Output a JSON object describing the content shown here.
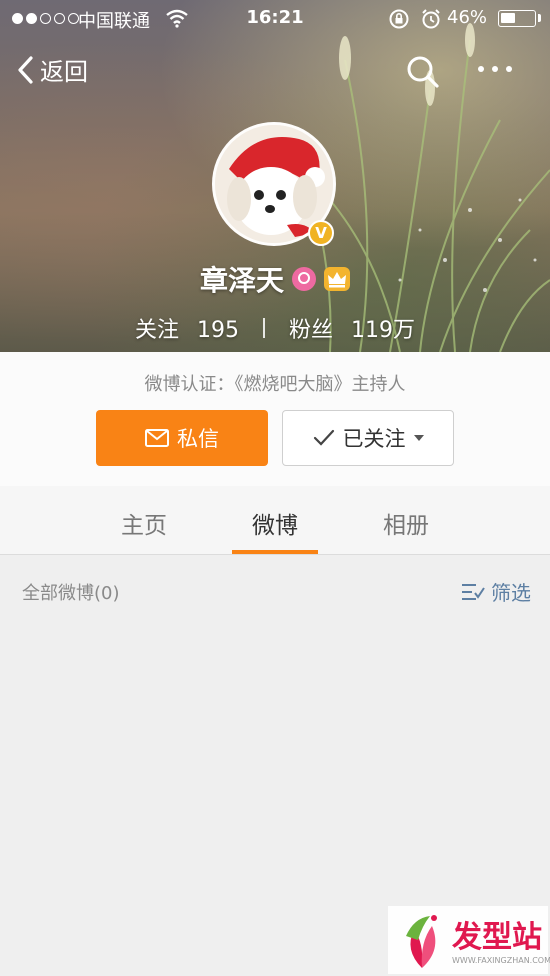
{
  "status_bar": {
    "carrier": "中国联通",
    "time": "16:21",
    "battery_percent": "46%",
    "battery_level": 0.46
  },
  "nav": {
    "back_label": "返回"
  },
  "profile": {
    "name": "章泽天",
    "verified_badge": "V",
    "following_label": "关注",
    "following_count": "195",
    "followers_label": "粉丝",
    "followers_count": "119万",
    "verification": "微博认证：《燃烧吧大脑》主持人"
  },
  "actions": {
    "message_label": "私信",
    "following_state_label": "已关注"
  },
  "tabs": [
    {
      "label": "主页",
      "active": false
    },
    {
      "label": "微博",
      "active": true
    },
    {
      "label": "相册",
      "active": false
    }
  ],
  "feed": {
    "title": "全部微博(0)",
    "filter_label": "筛选"
  },
  "watermark": {
    "text": "发型站",
    "sub": "WWW.FAXINGZHAN.COM"
  },
  "colors": {
    "accent": "#f98315",
    "link": "#5d7fa3",
    "verified": "#f0b323"
  }
}
